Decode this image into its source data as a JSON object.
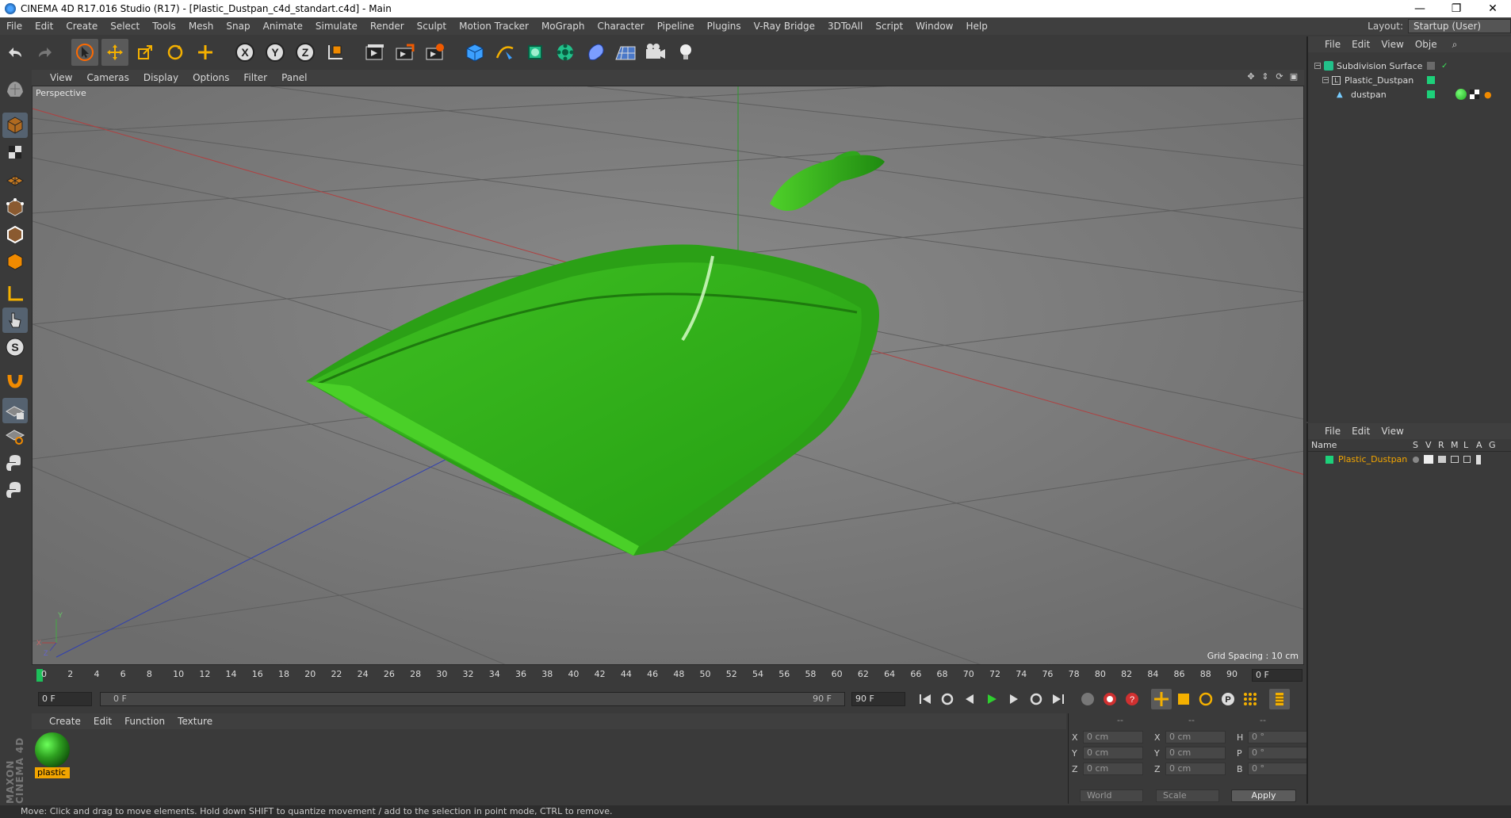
{
  "window": {
    "title": "CINEMA 4D R17.016 Studio (R17) - [Plastic_Dustpan_c4d_standart.c4d] - Main",
    "minimize": "—",
    "restore": "❐",
    "close": "✕"
  },
  "menu": [
    "File",
    "Edit",
    "Create",
    "Select",
    "Tools",
    "Mesh",
    "Snap",
    "Animate",
    "Simulate",
    "Render",
    "Sculpt",
    "Motion Tracker",
    "MoGraph",
    "Character",
    "Pipeline",
    "Plugins",
    "V-Ray Bridge",
    "3DToAll",
    "Script",
    "Window",
    "Help"
  ],
  "layout": {
    "label": "Layout:",
    "value": "Startup (User)"
  },
  "viewport": {
    "menu": [
      "View",
      "Cameras",
      "Display",
      "Options",
      "Filter",
      "Panel"
    ],
    "label": "Perspective",
    "grid_spacing": "Grid Spacing : 10 cm",
    "axis": {
      "y": "Y",
      "x": "X",
      "z": "Z"
    }
  },
  "timeline": {
    "ticks": [
      "0",
      "2",
      "4",
      "6",
      "8",
      "10",
      "12",
      "14",
      "16",
      "18",
      "20",
      "22",
      "24",
      "26",
      "28",
      "30",
      "32",
      "34",
      "36",
      "38",
      "40",
      "42",
      "44",
      "46",
      "48",
      "50",
      "52",
      "54",
      "56",
      "58",
      "60",
      "62",
      "64",
      "66",
      "68",
      "70",
      "72",
      "74",
      "76",
      "78",
      "80",
      "82",
      "84",
      "86",
      "88",
      "90"
    ],
    "end_field": "0 F"
  },
  "transport": {
    "start": "0 F",
    "range_start": "0 F",
    "range_end": "90 F",
    "end": "90 F"
  },
  "material_menu": [
    "Create",
    "Edit",
    "Function",
    "Texture"
  ],
  "materials": [
    {
      "name": "plastic",
      "color": "#2ea020"
    }
  ],
  "coordinates": {
    "header": [
      "--",
      "--",
      "--"
    ],
    "rows": [
      {
        "k1": "X",
        "v1": "0 cm",
        "k2": "X",
        "v2": "0 cm",
        "k3": "H",
        "v3": "0 °"
      },
      {
        "k1": "Y",
        "v1": "0 cm",
        "k2": "Y",
        "v2": "0 cm",
        "k3": "P",
        "v3": "0 °"
      },
      {
        "k1": "Z",
        "v1": "0 cm",
        "k2": "Z",
        "v2": "0 cm",
        "k3": "B",
        "v3": "0 °"
      }
    ],
    "mode": "World",
    "scale": "Scale",
    "apply": "Apply"
  },
  "object_manager": {
    "menu": [
      "File",
      "Edit",
      "View",
      "Obje"
    ],
    "objects": [
      {
        "name": "Subdivision Surface"
      },
      {
        "name": "Plastic_Dustpan"
      },
      {
        "name": "dustpan"
      }
    ]
  },
  "layers": {
    "menu": [
      "File",
      "Edit",
      "View"
    ],
    "columns": [
      "Name",
      "S",
      "V",
      "R",
      "M",
      "L",
      "A",
      "G"
    ],
    "rows": [
      {
        "name": "Plastic_Dustpan"
      }
    ]
  },
  "brand": "MAXON CINEMA 4D",
  "status": "Move: Click and drag to move elements. Hold down SHIFT to quantize movement / add to the selection in point mode, CTRL to remove.",
  "colors": {
    "accent": "#2ea020",
    "selection": "#f2a500",
    "bg": "#3a3a3a"
  }
}
